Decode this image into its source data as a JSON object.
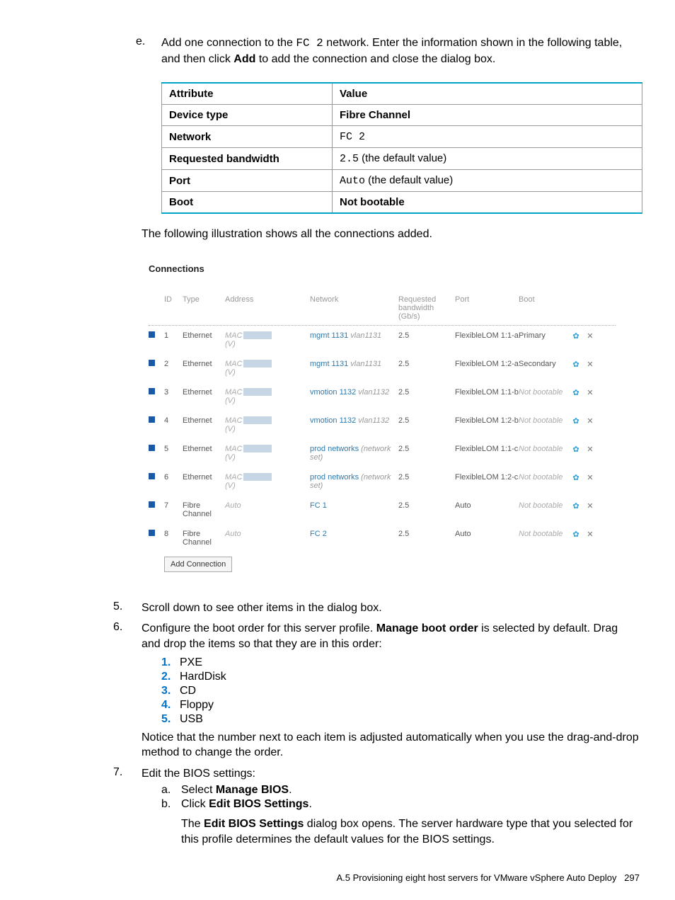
{
  "intro": {
    "marker": "e.",
    "line1a": "Add one connection to the ",
    "line1_code": "FC 2",
    "line1b": " network. Enter the information shown in the following table, and then click ",
    "line1_bold": "Add",
    "line1c": " to add the connection and close the dialog box."
  },
  "table": {
    "hdr_attr": "Attribute",
    "hdr_val": "Value",
    "rows": [
      {
        "attr": "Device type",
        "val": "Fibre Channel",
        "attr_bold": true,
        "val_bold": true
      },
      {
        "attr": "Network",
        "val_code": "FC 2",
        "attr_bold": true
      },
      {
        "attr": "Requested bandwidth",
        "val_code": "2.5",
        "val_post": " (the default value)",
        "attr_bold": true
      },
      {
        "attr": "Port",
        "val_code": "Auto",
        "val_post": " (the default value)",
        "attr_bold": true
      },
      {
        "attr": "Boot",
        "val": "Not bootable",
        "attr_bold": true,
        "val_bold": true
      }
    ]
  },
  "illustration_text": "The following illustration shows all the connections added.",
  "conn": {
    "title": "Connections",
    "hdr": {
      "id": "ID",
      "type": "Type",
      "addr": "Address",
      "net": "Network",
      "bw": "Requested bandwidth (Gb/s)",
      "port": "Port",
      "boot": "Boot"
    },
    "rows": [
      {
        "id": "1",
        "type": "Ethernet",
        "addr": "MAC",
        "addr2": "(V)",
        "net": "mgmt 1131",
        "netsub": "vlan1131",
        "bw": "2.5",
        "port": "FlexibleLOM 1:1-a",
        "boot": "Primary",
        "bootplain": true
      },
      {
        "id": "2",
        "type": "Ethernet",
        "addr": "MAC",
        "addr2": "(V)",
        "net": "mgmt 1131",
        "netsub": "vlan1131",
        "bw": "2.5",
        "port": "FlexibleLOM 1:2-a",
        "boot": "Secondary",
        "bootplain": true
      },
      {
        "id": "3",
        "type": "Ethernet",
        "addr": "MAC",
        "addr2": "(V)",
        "net": "vmotion 1132",
        "netsub": "vlan1132",
        "bw": "2.5",
        "port": "FlexibleLOM 1:1-b",
        "boot": "Not bootable"
      },
      {
        "id": "4",
        "type": "Ethernet",
        "addr": "MAC",
        "addr2": "(V)",
        "net": "vmotion 1132",
        "netsub": "vlan1132",
        "bw": "2.5",
        "port": "FlexibleLOM 1:2-b",
        "boot": "Not bootable"
      },
      {
        "id": "5",
        "type": "Ethernet",
        "addr": "MAC",
        "addr2": "(V)",
        "net": "prod networks",
        "netsub": "(network set)",
        "bw": "2.5",
        "port": "FlexibleLOM 1:1-c",
        "boot": "Not bootable"
      },
      {
        "id": "6",
        "type": "Ethernet",
        "addr": "MAC",
        "addr2": "(V)",
        "net": "prod networks",
        "netsub": "(network set)",
        "bw": "2.5",
        "port": "FlexibleLOM 1:2-c",
        "boot": "Not bootable"
      },
      {
        "id": "7",
        "type": "Fibre Channel",
        "addr_auto": "Auto",
        "net": "FC 1",
        "bw": "2.5",
        "port": "Auto",
        "boot": "Not bootable"
      },
      {
        "id": "8",
        "type": "Fibre Channel",
        "addr_auto": "Auto",
        "net": "FC 2",
        "bw": "2.5",
        "port": "Auto",
        "boot": "Not bootable"
      }
    ],
    "addbtn": "Add Connection"
  },
  "step5": {
    "num": "5.",
    "text": "Scroll down to see other items in the dialog box."
  },
  "step6": {
    "num": "6.",
    "lead": "Configure the boot order for this server profile. ",
    "bold": "Manage boot order",
    "after": " is selected by default. Drag and drop the items so that they are in this order:",
    "items": [
      "PXE",
      "HardDisk",
      "CD",
      "Floppy",
      "USB"
    ],
    "nums": [
      "1.",
      "2.",
      "3.",
      "4.",
      "5."
    ],
    "notice": "Notice that the number next to each item is adjusted automatically when you use the drag-and-drop method to change the order."
  },
  "step7": {
    "num": "7.",
    "lead": "Edit the BIOS settings:",
    "a_m": "a.",
    "a_pre": "Select ",
    "a_b": "Manage BIOS",
    "a_post": ".",
    "b_m": "b.",
    "b_pre": "Click ",
    "b_b": "Edit BIOS Settings",
    "b_post": ".",
    "para2_pre": "The ",
    "para2_b": "Edit BIOS Settings",
    "para2_post": " dialog box opens. The server hardware type that you selected for this profile determines the default values for the BIOS settings."
  },
  "footer": {
    "text": "A.5 Provisioning eight host servers for VMware vSphere Auto Deploy",
    "page": "297"
  }
}
